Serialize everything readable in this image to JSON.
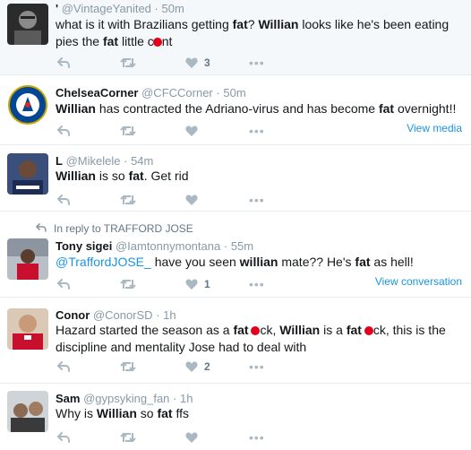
{
  "tweets": [
    {
      "name": "'",
      "handle": "@VintageYanited",
      "time": "50m",
      "segments": [
        {
          "t": "what is it with Brazilians getting ",
          "b": false
        },
        {
          "t": "fat",
          "b": true
        },
        {
          "t": "? ",
          "b": false
        },
        {
          "t": "Willian",
          "b": true
        },
        {
          "t": " looks like he's been eating pies the ",
          "b": false
        },
        {
          "t": "fat",
          "b": true
        },
        {
          "t": " little c",
          "b": false
        },
        {
          "t": "",
          "b": false,
          "redact": true
        },
        {
          "t": "nt",
          "b": false
        }
      ],
      "like_count": "3",
      "retweet_count": ""
    },
    {
      "name": "ChelseaCorner",
      "handle": "@CFCCorner",
      "time": "50m",
      "segments": [
        {
          "t": "Willian",
          "b": true
        },
        {
          "t": " has contracted the Adriano-virus and has become ",
          "b": false
        },
        {
          "t": "fat",
          "b": true
        },
        {
          "t": " overnight!!",
          "b": false
        }
      ],
      "like_count": "",
      "side_link": "View media"
    },
    {
      "name": "L",
      "handle": "@Mikelele",
      "time": "54m",
      "segments": [
        {
          "t": "Willian",
          "b": true
        },
        {
          "t": " is so ",
          "b": false
        },
        {
          "t": "fat",
          "b": true
        },
        {
          "t": ". Get rid",
          "b": false
        }
      ],
      "like_count": ""
    },
    {
      "reply_to": "In reply to TRAFFORD JOSE",
      "name": "Tony sigei",
      "handle": "@Iamtonnymontana",
      "time": "55m",
      "segments": [
        {
          "t": "@TraffordJOSE_",
          "b": false,
          "mention": true
        },
        {
          "t": "  have you seen ",
          "b": false
        },
        {
          "t": "willian",
          "b": true
        },
        {
          "t": " mate?? He's ",
          "b": false
        },
        {
          "t": "fat",
          "b": true
        },
        {
          "t": " as hell!",
          "b": false
        }
      ],
      "like_count": "1",
      "side_link": "View conversation"
    },
    {
      "name": "Conor",
      "handle": "@ConorSD",
      "time": "1h",
      "segments": [
        {
          "t": "Hazard started the season as a ",
          "b": false
        },
        {
          "t": "fat",
          "b": true
        },
        {
          "t": " ",
          "b": false
        },
        {
          "t": "",
          "b": false,
          "redact": true
        },
        {
          "t": "ck, ",
          "b": false
        },
        {
          "t": "Willian",
          "b": true
        },
        {
          "t": " is a ",
          "b": false
        },
        {
          "t": "fat",
          "b": true
        },
        {
          "t": " ",
          "b": false
        },
        {
          "t": "",
          "b": false,
          "redact": true
        },
        {
          "t": "ck, this is the discipline and mentality Jose had to deal with",
          "b": false
        }
      ],
      "like_count": "2"
    },
    {
      "name": "Sam",
      "handle": "@gypsyking_fan",
      "time": "1h",
      "segments": [
        {
          "t": "Why is ",
          "b": false
        },
        {
          "t": "Willian",
          "b": true
        },
        {
          "t": " so ",
          "b": false
        },
        {
          "t": "fat",
          "b": true
        },
        {
          "t": " ffs",
          "b": false
        }
      ],
      "like_count": ""
    }
  ],
  "colors": {
    "link": "#1b95e0",
    "muted": "#8899a6",
    "icon": "#aab8c2",
    "redaction": "#e3001b",
    "divider": "#e6ecf0"
  },
  "icons": [
    "reply-icon",
    "retweet-icon",
    "like-icon",
    "more-icon",
    "reply-arrow-icon"
  ]
}
